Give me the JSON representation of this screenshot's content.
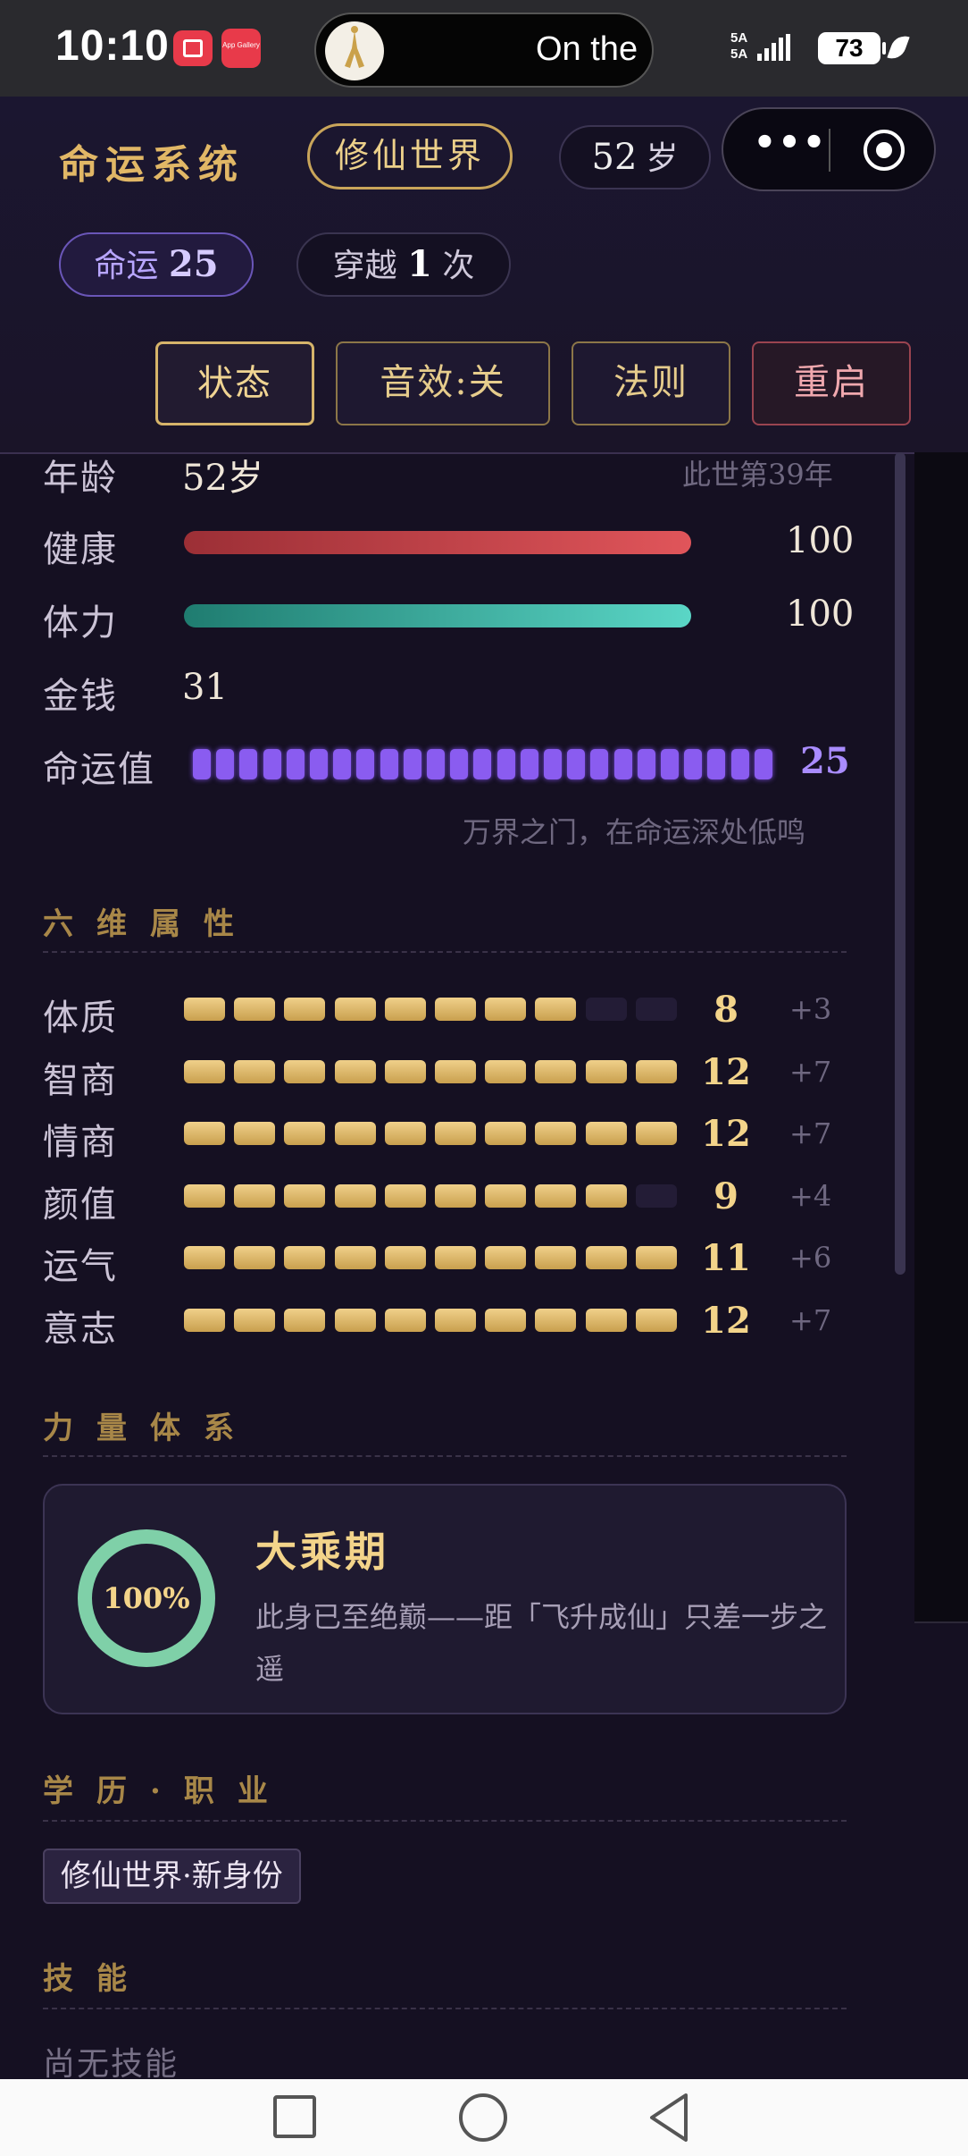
{
  "status_bar": {
    "time": "10:10",
    "app_gallery_label": "App Gallery",
    "music_text": "On the",
    "network_top": "5A",
    "network_bottom": "5A",
    "battery": "73"
  },
  "header": {
    "app_title": "命运系统",
    "world": "修仙世界",
    "age_value": "52",
    "age_unit": "岁",
    "fate_label": "命运",
    "fate_value": "25",
    "travel_prefix": "穿越",
    "travel_count": "1",
    "travel_suffix": "次",
    "buttons": {
      "status": "状态",
      "sound": "音效:关",
      "rules": "法则",
      "restart": "重启"
    }
  },
  "status": {
    "age_label": "年龄",
    "age_value": "52岁",
    "age_note": "此世第39年",
    "health_label": "健康",
    "health_value": "100",
    "health_ratio": 1.0,
    "stamina_label": "体力",
    "stamina_value": "100",
    "stamina_ratio": 1.0,
    "money_label": "金钱",
    "money_value": "31",
    "fate_label": "命运值",
    "fate_value": "25",
    "fate_hint": "万界之门，在命运深处低鸣"
  },
  "attributes": {
    "title": "六维属性",
    "max": 10,
    "items": [
      {
        "name": "体质",
        "value": "8",
        "level": 8,
        "bonus": "+3"
      },
      {
        "name": "智商",
        "value": "12",
        "level": 10,
        "bonus": "+7"
      },
      {
        "name": "情商",
        "value": "12",
        "level": 10,
        "bonus": "+7"
      },
      {
        "name": "颜值",
        "value": "9",
        "level": 9,
        "bonus": "+4"
      },
      {
        "name": "运气",
        "value": "11",
        "level": 10,
        "bonus": "+6"
      },
      {
        "name": "意志",
        "value": "12",
        "level": 10,
        "bonus": "+7"
      }
    ]
  },
  "power": {
    "title": "力量体系",
    "progress_text": "100%",
    "progress": 1.0,
    "realm": "大乘期",
    "description": "此身已至绝巅——距「飞升成仙」只差一步之遥"
  },
  "career": {
    "title": "学历·职业",
    "tag": "修仙世界·新身份"
  },
  "skills": {
    "title": "技能",
    "empty_text": "尚无技能"
  },
  "colors": {
    "gold": "#e1b766",
    "purple": "#8a5cf0",
    "health": "#e0555a",
    "stamina": "#5ad6c6",
    "ring": "#7fd0a8"
  }
}
